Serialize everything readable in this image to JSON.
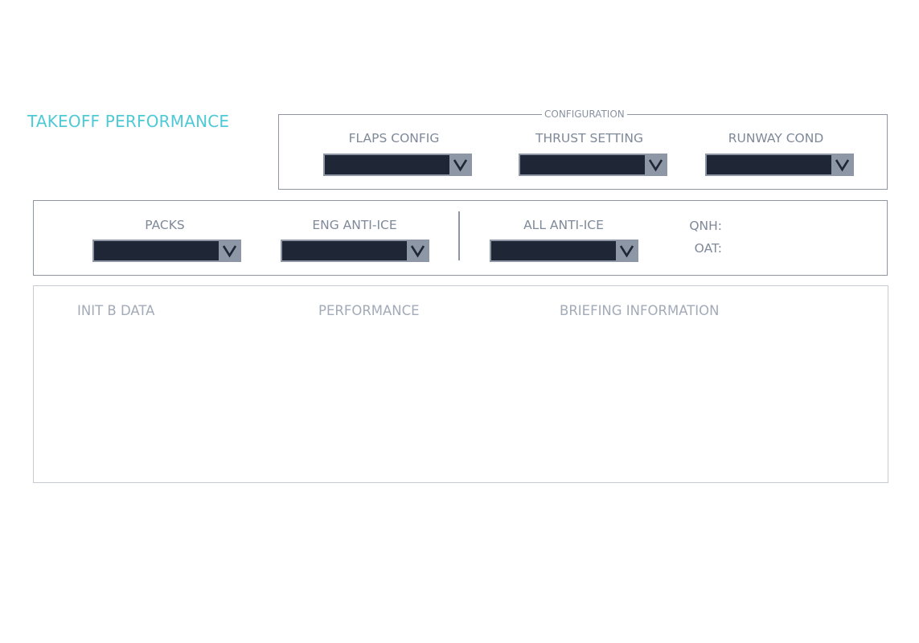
{
  "title": "TAKEOFF PERFORMANCE",
  "configuration": {
    "legend": "CONFIGURATION",
    "fields": [
      {
        "label": "FLAPS CONFIG",
        "value": ""
      },
      {
        "label": "THRUST SETTING",
        "value": ""
      },
      {
        "label": "RUNWAY COND",
        "value": ""
      }
    ]
  },
  "air": {
    "fields": [
      {
        "label": "PACKS",
        "value": ""
      },
      {
        "label": "ENG ANTI-ICE",
        "value": ""
      },
      {
        "label": "ALL ANTI-ICE",
        "value": ""
      }
    ],
    "qnh_label": "QNH:",
    "qnh_value": "",
    "oat_label": "OAT:",
    "oat_value": ""
  },
  "tabs": [
    {
      "label": "INIT B DATA"
    },
    {
      "label": "PERFORMANCE"
    },
    {
      "label": "BRIEFING INFORMATION"
    }
  ],
  "icons": {
    "dropdown": "chevron-down-icon"
  },
  "colors": {
    "title": "#4ec9d6",
    "label": "#7f8999",
    "select_field": "#1f2736",
    "select_button": "#8e97a6",
    "border": "#8e96a3",
    "tab_text": "#a3abb8"
  }
}
